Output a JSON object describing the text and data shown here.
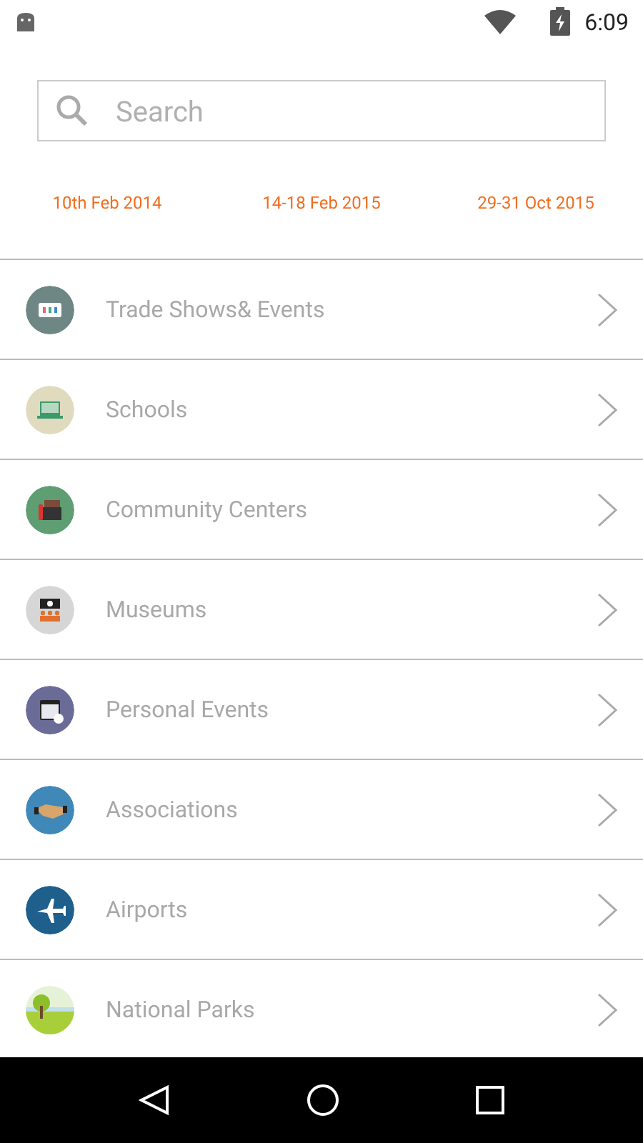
{
  "status_bar": {
    "time": "6:09"
  },
  "search": {
    "placeholder": "Search"
  },
  "events": [
    {
      "date": "10th Feb 2014"
    },
    {
      "date": "14-18 Feb 2015"
    },
    {
      "date": "29-31 Oct 2015"
    }
  ],
  "categories": [
    {
      "label": "Trade Shows& Events",
      "kind": "tradeshow",
      "color": "#6e8784"
    },
    {
      "label": "Schools",
      "kind": "school",
      "color": "#e0dbbf"
    },
    {
      "label": "Community Centers",
      "kind": "community",
      "color": "#5e9e72"
    },
    {
      "label": "Museums",
      "kind": "museum",
      "color": "#d6d6d6"
    },
    {
      "label": "Personal Events",
      "kind": "calendar",
      "color": "#6a6b96"
    },
    {
      "label": "Associations",
      "kind": "handshake",
      "color": "#3f88b8"
    },
    {
      "label": "Airports",
      "kind": "airport",
      "color": "#1f5f8c"
    },
    {
      "label": "National Parks",
      "kind": "park",
      "color": "#e6f2d8"
    }
  ]
}
